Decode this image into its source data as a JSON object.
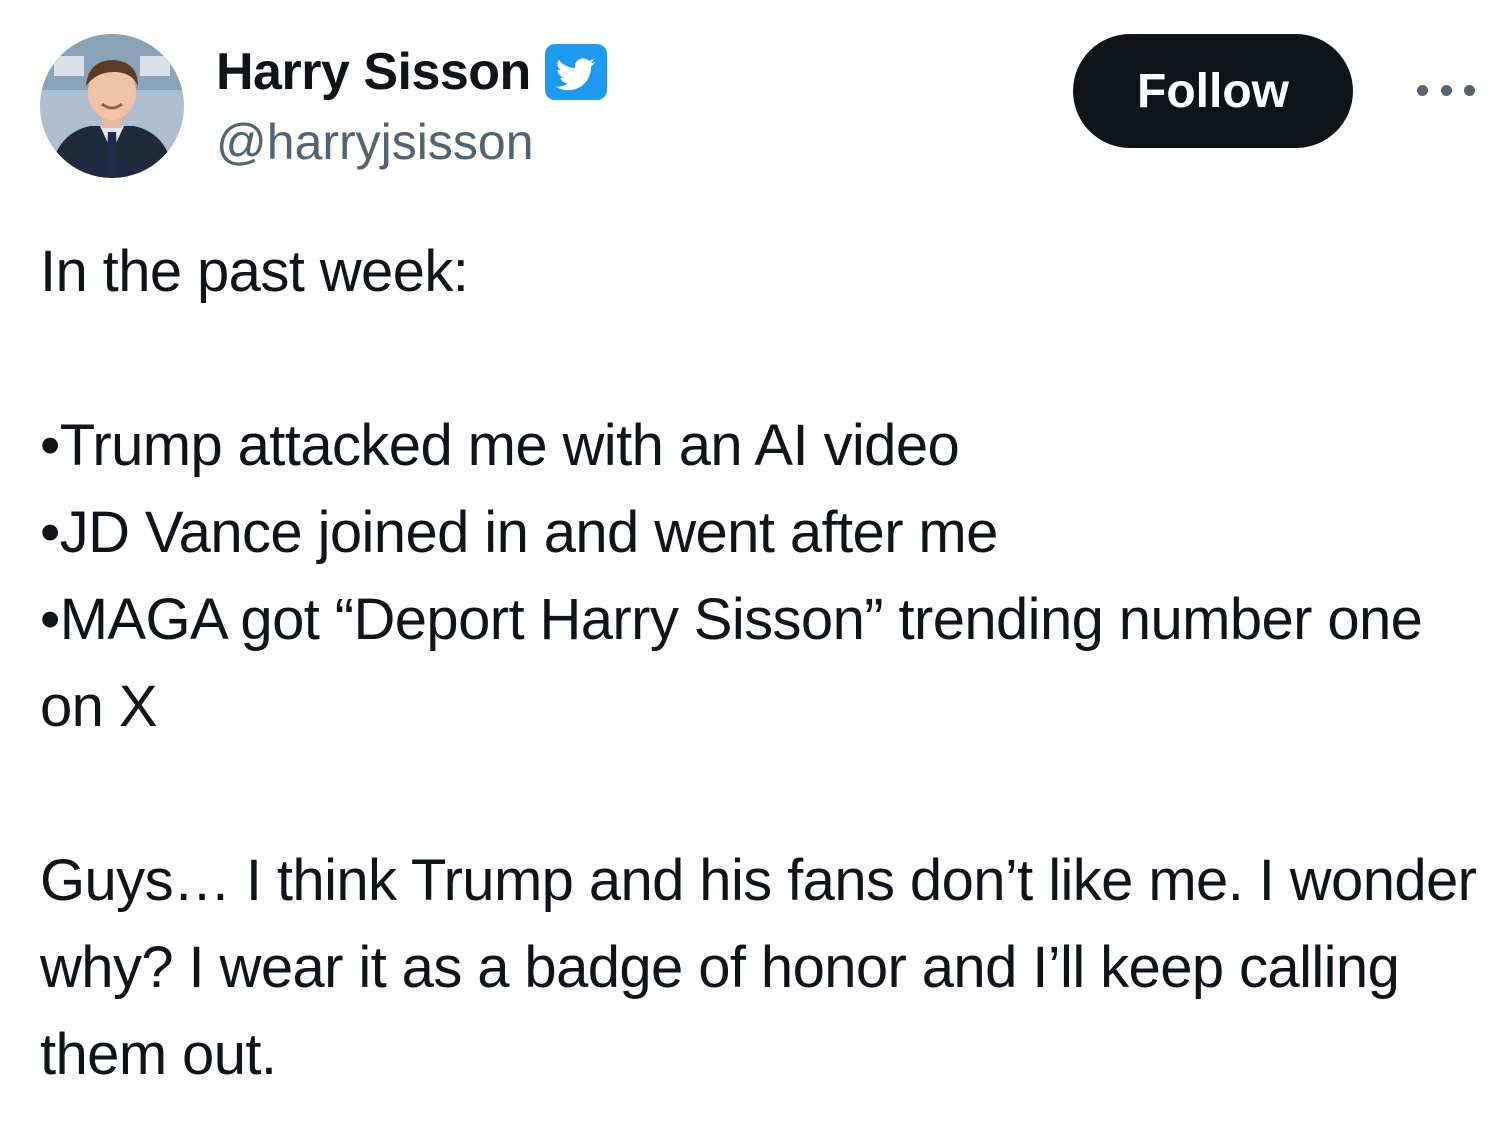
{
  "author": {
    "display_name": "Harry Sisson",
    "handle": "@harryjsisson",
    "verified": true,
    "verified_badge_color": "#1d9bf0"
  },
  "actions": {
    "follow_label": "Follow",
    "more_icon": "ellipsis-icon"
  },
  "tweet": {
    "intro": "In the past week:",
    "bullets": [
      "•Trump attacked me with an AI video",
      "•JD Vance joined in and went after me",
      "•MAGA got “Deport Harry Sisson” trending number one on X"
    ],
    "closing": "Guys… I think Trump and his fans don’t like me. I wonder why? I wear it as a badge of honor and I’ll keep calling them out."
  },
  "colors": {
    "text": "#0f1419",
    "secondary_text": "#536471",
    "follow_bg": "#0f1419",
    "follow_text": "#ffffff"
  }
}
